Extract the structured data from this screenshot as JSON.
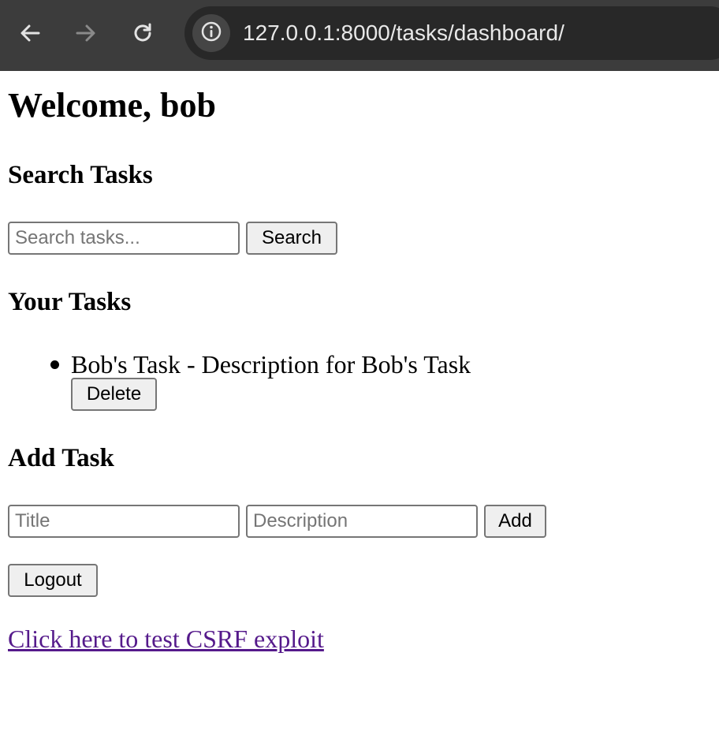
{
  "browser": {
    "url": "127.0.0.1:8000/tasks/dashboard/",
    "icons": [
      "back-arrow-icon",
      "forward-arrow-icon",
      "reload-icon",
      "site-info-icon"
    ]
  },
  "page": {
    "welcome": "Welcome, bob",
    "search": {
      "heading": "Search Tasks",
      "placeholder": "Search tasks...",
      "value": "",
      "button_label": "Search"
    },
    "tasks": {
      "heading": "Your Tasks",
      "items": [
        {
          "text": "Bob's Task - Description for Bob's Task",
          "delete_label": "Delete"
        }
      ]
    },
    "add": {
      "heading": "Add Task",
      "title_placeholder": "Title",
      "description_placeholder": "Description",
      "button_label": "Add"
    },
    "logout_label": "Logout",
    "csrf_link": "Click here to test CSRF exploit"
  },
  "colors": {
    "chrome_bg": "#3c3c3c",
    "omnibox_bg": "#282828",
    "visited_link": "#551a8b"
  }
}
